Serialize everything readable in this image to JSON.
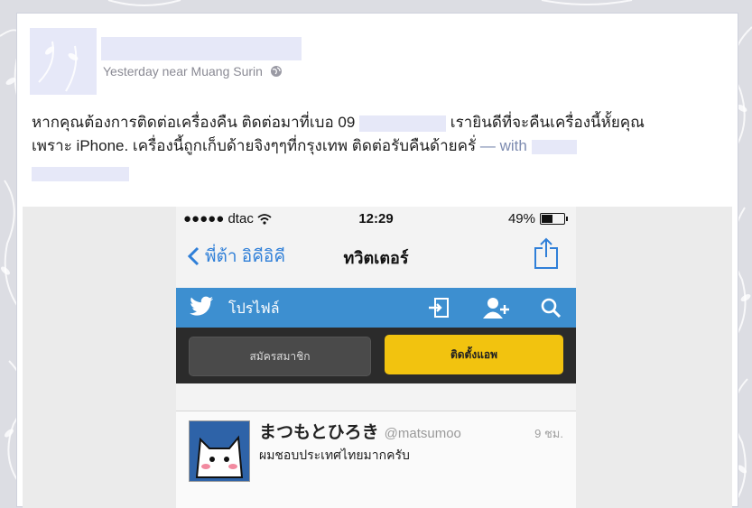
{
  "post": {
    "meta_text": "Yesterday near Muang Surin",
    "text_part1": "หากคุณต้องการติดต่อเครื่องคืน ติดต่อมาที่เบอ 09",
    "text_part2": "เรายินดีที่จะคืนเครื่องนี้หั้ยคุณ",
    "text_part3": "เพราะ iPhone. เครื่องนี้ถูกเก็บด้ายจิงๆๆที่กรุงเทพ ติดต่อรับคืนด้ายครั่",
    "with_label": "— with"
  },
  "phone": {
    "status": {
      "carrier": "●●●●● dtac",
      "time": "12:29",
      "battery": "49%"
    },
    "nav": {
      "back_label": "พี่ต้า อิคีอิคี",
      "title": "ทวิตเตอร์"
    },
    "twitter_bar": {
      "label": "โปรไฟล์"
    },
    "buttons": {
      "signup": "สมัครสมาชิก",
      "install": "ติดตั้งแอพ"
    },
    "tweet": {
      "name": "まつもとひろき",
      "handle": "@matsumoo",
      "time": "9 ชม.",
      "text": "ผมชอบประเทศไทยมากครับ"
    }
  },
  "colors": {
    "twitter_blue": "#3d8fd0",
    "install_yellow": "#f2c30f",
    "link_blue": "#2f7fd8"
  },
  "icons": [
    "globe-icon",
    "back-chevron-icon",
    "share-icon",
    "twitter-bird-icon",
    "sign-in-icon",
    "add-user-icon",
    "search-icon",
    "wifi-icon",
    "battery-icon"
  ]
}
